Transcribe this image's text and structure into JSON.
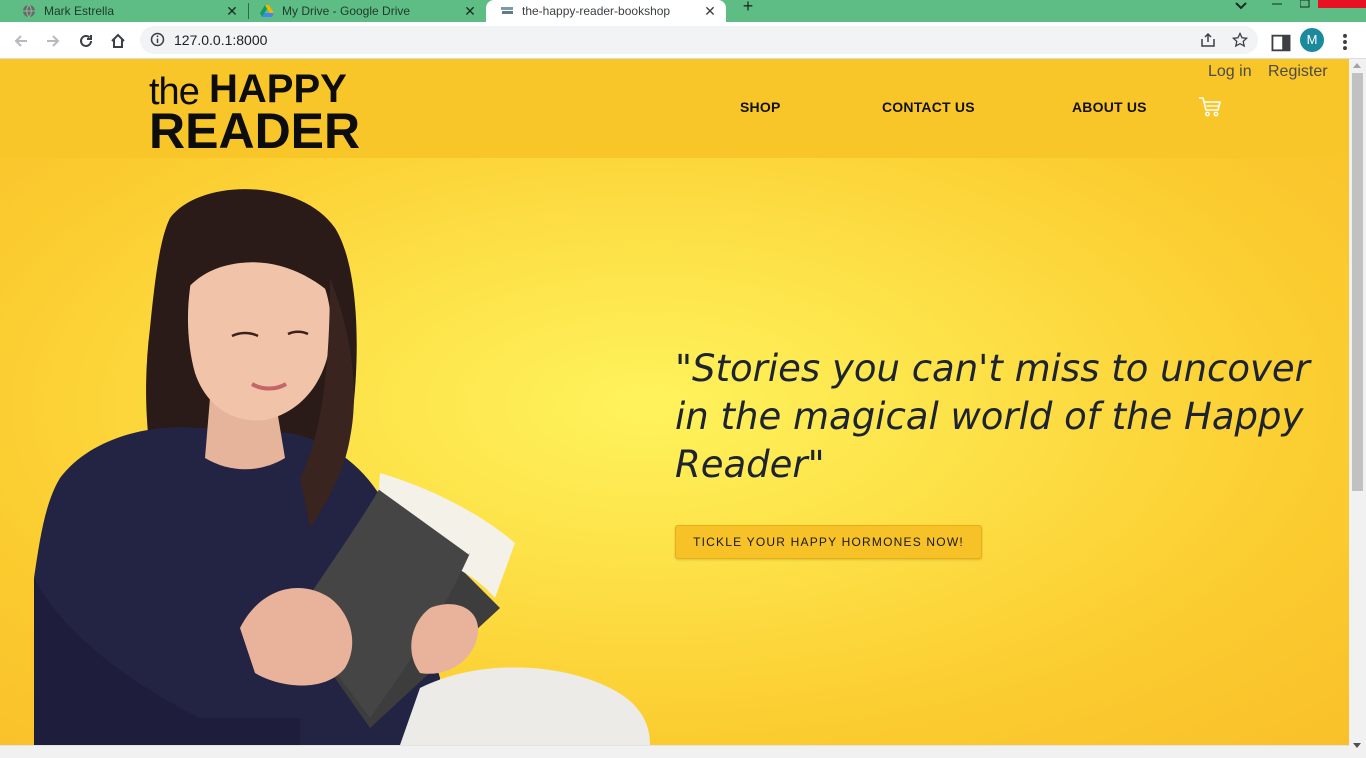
{
  "browser": {
    "tabs": [
      {
        "title": "Mark Estrella",
        "active": false
      },
      {
        "title": "My Drive - Google Drive",
        "active": false
      },
      {
        "title": "the-happy-reader-bookshop",
        "active": true
      }
    ],
    "address": "127.0.0.1:8000",
    "profile_initial": "M",
    "colors": {
      "tabstrip": "#5dbd85",
      "avatar": "#1a8a9c"
    }
  },
  "site": {
    "logo": {
      "the": "the",
      "happy": "HAPPY",
      "reader": "READER"
    },
    "nav": [
      {
        "label": "SHOP"
      },
      {
        "label": "CONTACT US"
      },
      {
        "label": "ABOUT US"
      }
    ],
    "auth": {
      "login": "Log in",
      "register": "Register"
    },
    "cart_icon": "cart-icon",
    "hero": {
      "quote": "\"Stories you can't miss to uncover in the magical world of the Happy Reader\"",
      "cta_label": "TICKLE YOUR HAPPY HORMONES NOW!"
    },
    "colors": {
      "header": "#f9c62a",
      "hero_center": "#fff35c",
      "cta": "#f7c128"
    }
  }
}
